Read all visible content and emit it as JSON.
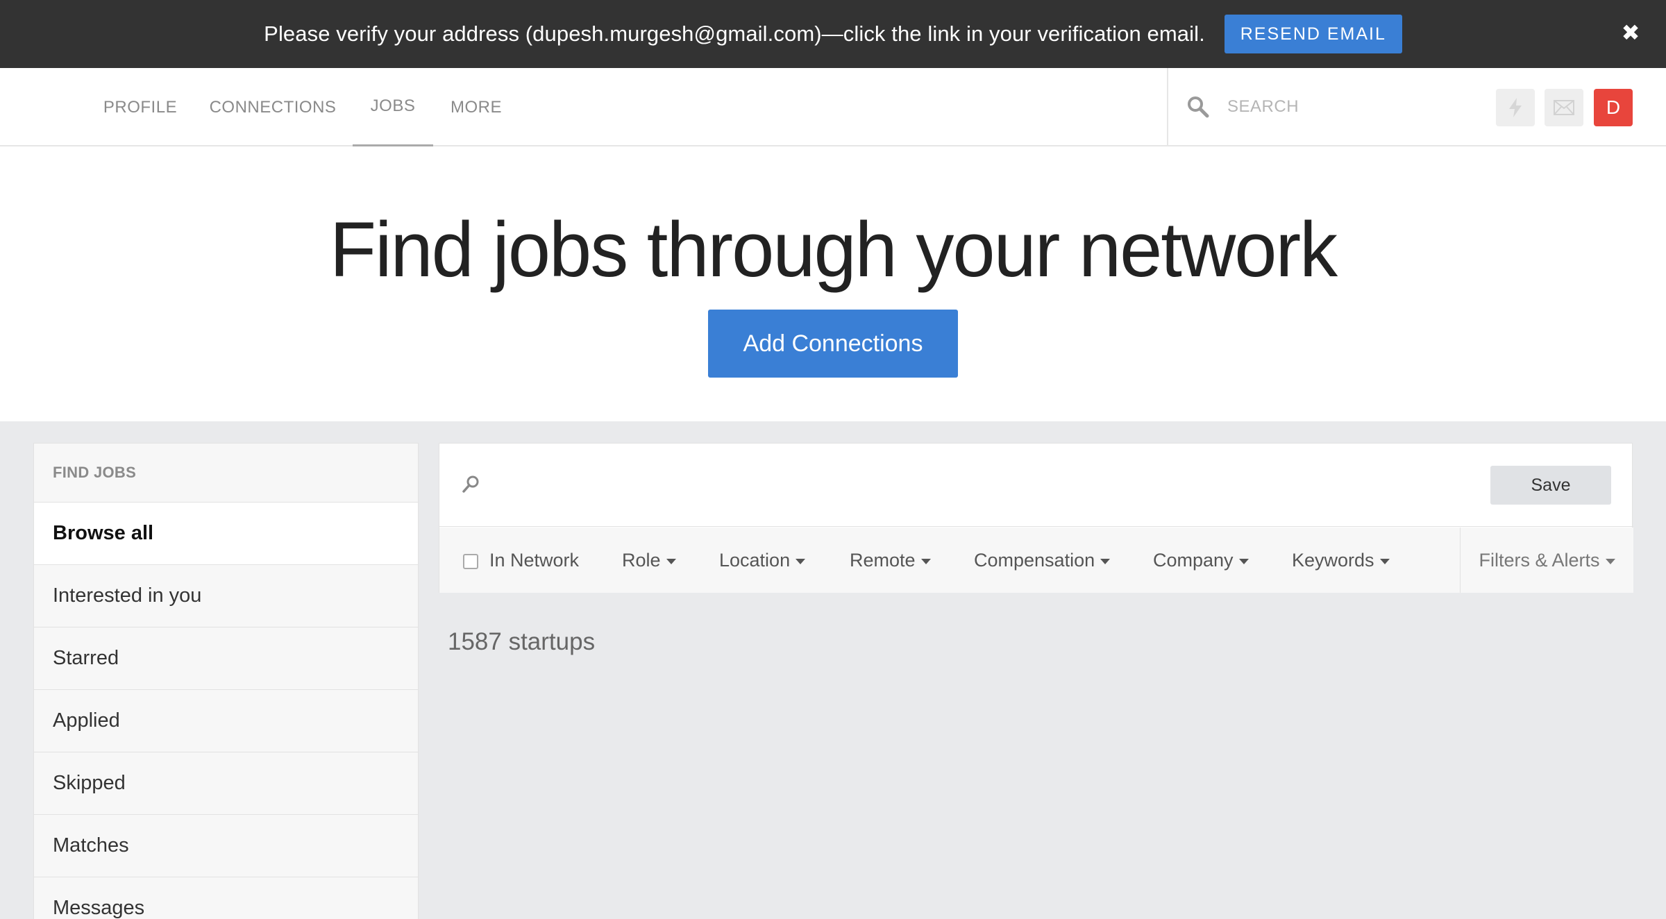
{
  "banner": {
    "message": "Please verify your address (dupesh.murgesh@gmail.com)—click the link in your verification email.",
    "resend_label": "RESEND EMAIL",
    "close_glyph": "✖"
  },
  "nav": {
    "tabs": [
      {
        "label": "PROFILE",
        "active": false
      },
      {
        "label": "CONNECTIONS",
        "active": false
      },
      {
        "label": "JOBS",
        "active": true
      },
      {
        "label": "MORE",
        "active": false
      }
    ],
    "search_placeholder": "SEARCH",
    "icons": [
      "lightning-icon",
      "mail-icon"
    ],
    "avatar_initial": "D",
    "avatar_color": "#e8453c"
  },
  "hero": {
    "title": "Find jobs through your network",
    "cta_label": "Add Connections",
    "accent_color": "#3a7fd5"
  },
  "sidebar": {
    "header": "FIND JOBS",
    "items": [
      {
        "label": "Browse all",
        "active": true
      },
      {
        "label": "Interested in you",
        "active": false
      },
      {
        "label": "Starred",
        "active": false
      },
      {
        "label": "Applied",
        "active": false
      },
      {
        "label": "Skipped",
        "active": false
      },
      {
        "label": "Matches",
        "active": false
      },
      {
        "label": "Messages",
        "active": false
      }
    ]
  },
  "main": {
    "query_value": "",
    "save_label": "Save",
    "filters": {
      "in_network": {
        "label": "In Network",
        "checked": false
      },
      "dropdowns": [
        "Role",
        "Location",
        "Remote",
        "Compensation",
        "Company",
        "Keywords"
      ],
      "filters_alerts": "Filters & Alerts"
    },
    "results_count": "1587 startups"
  }
}
